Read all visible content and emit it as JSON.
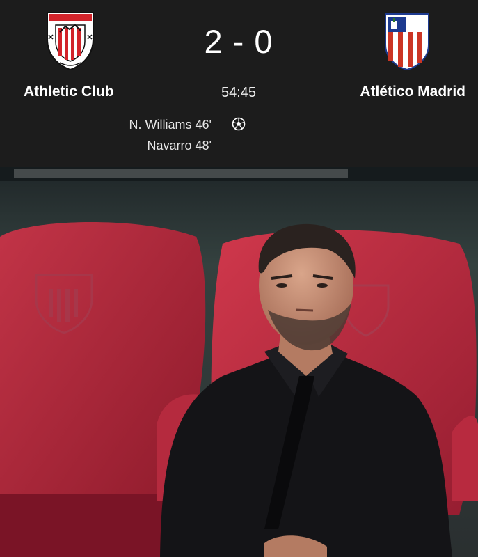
{
  "match": {
    "home_team": "Athletic Club",
    "away_team": "Atlético Madrid",
    "home_score": "2",
    "away_score": "0",
    "score_display": "2 - 0",
    "clock": "54:45",
    "scorers": [
      {
        "text": "N. Williams 46'"
      },
      {
        "text": "Navarro 48'"
      }
    ],
    "goal_icon": "soccer-ball-icon"
  },
  "crests": {
    "home": {
      "icon": "athletic-club-crest",
      "colors": {
        "red": "#d2232a",
        "white": "#ffffff",
        "black": "#111111"
      }
    },
    "away": {
      "icon": "atletico-madrid-crest",
      "colors": {
        "red": "#cb3524",
        "white": "#ffffff",
        "blue": "#1d3a8f"
      }
    }
  },
  "photo": {
    "subject": "manager-on-bench",
    "colors": {
      "seat": "#b5243a",
      "shirt": "#151518",
      "background": "#2f3a3c"
    }
  },
  "colors": {
    "header_background": "#1c1c1c",
    "text": "#ffffff"
  }
}
